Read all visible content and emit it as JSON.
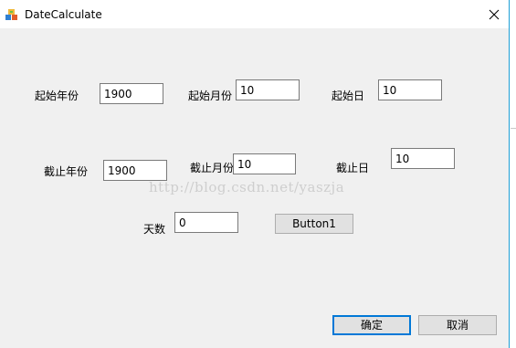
{
  "window": {
    "title": "DateCalculate",
    "accent_color": "#1e9fd6"
  },
  "labels": {
    "start_year": "起始年份",
    "start_month": "起始月份",
    "start_day": "起始日",
    "end_year": "截止年份",
    "end_month": "截止月份",
    "end_day": "截止日",
    "days": "天数"
  },
  "fields": {
    "start_year": "1900",
    "start_month": "10",
    "start_day": "10",
    "end_year": "1900",
    "end_month": "10",
    "end_day": "10",
    "days": "0"
  },
  "buttons": {
    "button1": "Button1",
    "ok": "确定",
    "cancel": "取消"
  },
  "watermark": "http://blog.csdn.net/yaszja",
  "icons": {
    "app": "app-icon",
    "close": "close-icon"
  }
}
